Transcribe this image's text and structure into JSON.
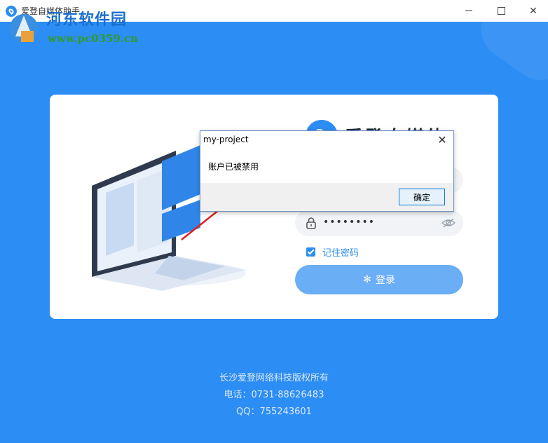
{
  "window": {
    "title": "爱登自媒体助手",
    "controls": [
      "minimize",
      "maximize",
      "close"
    ]
  },
  "watermark": {
    "text": "河东软件园",
    "url": "www.pc0359.cn"
  },
  "brand": {
    "name": "爱登自媒体",
    "accent_color": "#2c8df4"
  },
  "login": {
    "username_value": "",
    "password_value": "••••••••",
    "remember_label": "记住密码",
    "remember_checked": true,
    "login_label": "登录"
  },
  "footer": {
    "company": "长沙爱登网络科技版权所有",
    "phone": "电话：0731-88626483",
    "qq": "QQ：755243601"
  },
  "dialog": {
    "title": "my-project",
    "message": "账户已被禁用",
    "ok_label": "确定"
  }
}
